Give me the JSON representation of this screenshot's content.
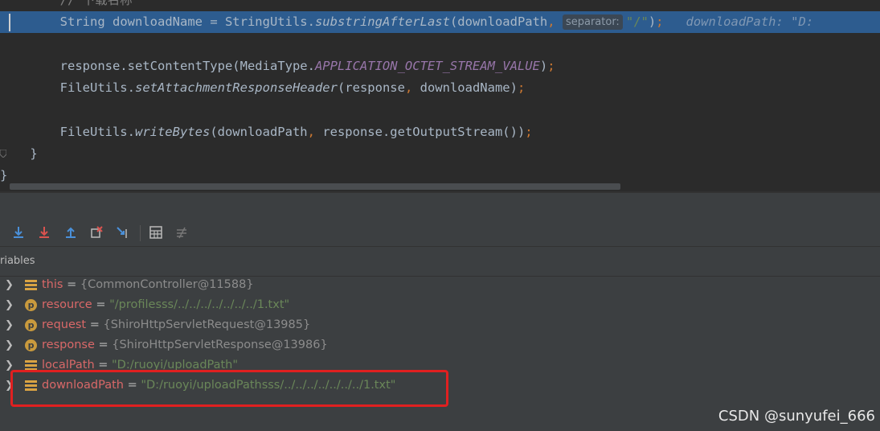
{
  "editor": {
    "lines": [
      {
        "indent": "        ",
        "comment": "// 下载名称"
      },
      {
        "indent": "        ",
        "type": "String",
        "var": "downloadName",
        "assign": " = StringUtils.",
        "method": "substringAfterLast",
        "open": "(downloadPath",
        "comma": ",",
        "hint": "separator:",
        "arg": "\"/\"",
        "close": ")",
        "semi": ";",
        "inline": "downloadPath: \"D:"
      },
      {
        "indent": "        ",
        "obj": "response.setContentType(MediaType.",
        "const": "APPLICATION_OCTET_STREAM_VALUE",
        "close": ")",
        "semi": ";"
      },
      {
        "indent": "        ",
        "obj": "FileUtils.",
        "method": "setAttachmentResponseHeader",
        "args": "(response",
        "comma": ",",
        "args2": " downloadName)",
        "semi": ";"
      },
      {
        "indent": "        ",
        "obj": "FileUtils.",
        "method": "writeBytes",
        "args": "(downloadPath",
        "comma": ",",
        "args2": " response.getOutputStream())",
        "semi": ";"
      },
      {
        "text": "    }"
      },
      {
        "text": "}"
      }
    ]
  },
  "debug": {
    "panel_label": "riables",
    "toolbar": [
      "step-over-icon",
      "step-into-icon",
      "step-out-icon",
      "drop-frame-icon",
      "run-to-cursor-icon",
      "evaluate-icon",
      "trace-icon"
    ],
    "variables": [
      {
        "name": "this",
        "kind": "field",
        "eq": " = ",
        "value": "{CommonController@11588}",
        "value_type": "obj"
      },
      {
        "name": "resource",
        "kind": "param",
        "eq": " = ",
        "value": "\"/profilesss/../../../../../../../1.txt\"",
        "value_type": "str"
      },
      {
        "name": "request",
        "kind": "param",
        "eq": " = ",
        "value": "{ShiroHttpServletRequest@13985}",
        "value_type": "obj"
      },
      {
        "name": "response",
        "kind": "param",
        "eq": " = ",
        "value": "{ShiroHttpServletResponse@13986}",
        "value_type": "obj"
      },
      {
        "name": "localPath",
        "kind": "field",
        "eq": " = ",
        "value": "\"D:/ruoyi/uploadPath\"",
        "value_type": "str"
      },
      {
        "name": "downloadPath",
        "kind": "field",
        "eq": " = ",
        "value": "\"D:/ruoyi/uploadPathsss/../../../../../../../1.txt\"",
        "value_type": "str"
      }
    ]
  },
  "watermark": "CSDN @sunyufei_666",
  "colors": {
    "highlight": "#e02020",
    "current_line": "#2d5c8f"
  }
}
